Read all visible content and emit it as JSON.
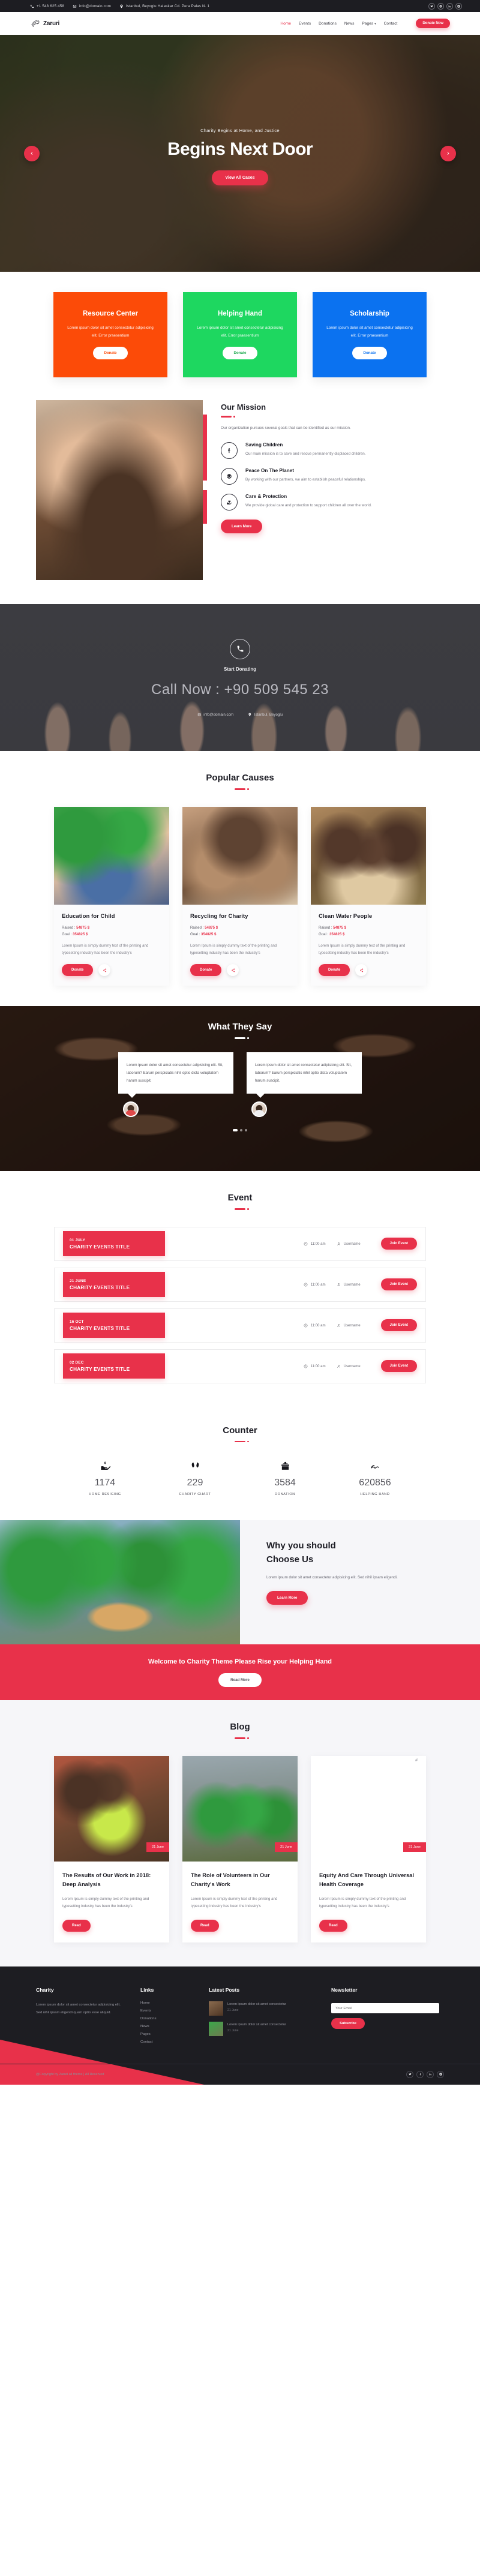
{
  "topbar": {
    "phone": "+1 548 625 458",
    "email": "info@domain.com",
    "address": "Istanbul, Beyoglu Halaskar Cd. Pera Palas N. 1",
    "socials": [
      "twitter-icon",
      "google-icon",
      "linkedin-icon",
      "instagram-icon"
    ]
  },
  "nav": {
    "brand": "Zaruri",
    "items": [
      {
        "label": "Home",
        "active": true
      },
      {
        "label": "Events",
        "active": false
      },
      {
        "label": "Donations",
        "active": false
      },
      {
        "label": "News",
        "active": false
      },
      {
        "label": "Pages",
        "active": false,
        "caret": true
      },
      {
        "label": "Contact",
        "active": false
      }
    ],
    "cta": "Donate Now"
  },
  "hero": {
    "subtitle": "Charity Begins at Home, and Justice",
    "title": "Begins Next Door",
    "button": "View All Cases",
    "prev": "‹",
    "next": "›"
  },
  "services": [
    {
      "title": "Resource Center",
      "text": "Lorem ipsum dolor sit amet consectetur adipisicing elit. Error praesentium",
      "button": "Donate",
      "bg": "#fc4b08",
      "fg": "#fc4b08"
    },
    {
      "title": "Helping Hand",
      "text": "Lorem ipsum dolor sit amet consectetur adipisicing elit. Error praesentium",
      "button": "Donate",
      "bg": "#1ed760",
      "fg": "#1ed760"
    },
    {
      "title": "Scholarship",
      "text": "Lorem ipsum dolor sit amet consectetur adipisicing elit. Error praesentium",
      "button": "Donate",
      "bg": "#0b72f0",
      "fg": "#0b72f0"
    }
  ],
  "mission": {
    "heading": "Our Mission",
    "description": "Our organization pursues several goals that can be identified as our mission.",
    "items": [
      {
        "icon": "child-icon",
        "title": "Saving Children",
        "text": "Our main mission is to save and rescue permanently displaced children."
      },
      {
        "icon": "peace-icon",
        "title": "Peace On The Planet",
        "text": "By working with our partners, we aim to establish peaceful relationships."
      },
      {
        "icon": "care-hand-icon",
        "title": "Care & Protection",
        "text": "We provide global care and protection to support children all over the world."
      }
    ],
    "button": "Learn More"
  },
  "callband": {
    "icon": "phone-icon",
    "subtitle": "Start Donating",
    "number": "Call Now : +90 509 545 23",
    "email": "info@domain.com",
    "location": "Istanbul, Beyoglu"
  },
  "causes": {
    "heading": "Popular Causes",
    "items": [
      {
        "title": "Education for Child",
        "raised_label": "Raised :",
        "raised_value": "54875 $",
        "goal_label": "Goal :",
        "goal_value": "354825 $",
        "text": "Lorem Ipsum is simply dummy text of the printing and typesetting industry has been the industry's",
        "button": "Donate",
        "share": "share-icon"
      },
      {
        "title": "Recycling for Charity",
        "raised_label": "Raised :",
        "raised_value": "54875 $",
        "goal_label": "Goal :",
        "goal_value": "354825 $",
        "text": "Lorem Ipsum is simply dummy text of the printing and typesetting industry has been the industry's",
        "button": "Donate",
        "share": "share-icon"
      },
      {
        "title": "Clean Water People",
        "raised_label": "Raised :",
        "raised_value": "54875 $",
        "goal_label": "Goal :",
        "goal_value": "354825 $",
        "text": "Lorem Ipsum is simply dummy text of the printing and typesetting industry has been the industry's",
        "button": "Donate",
        "share": "share-icon"
      }
    ]
  },
  "testimonials": {
    "heading": "What They Say",
    "items": [
      {
        "quote": "Lorem ipsum dolor sit amet consectetur adipisicing elit. Sit, laborum? Earum perspiciatis nihil optio dicta voluptatem harum suscipit."
      },
      {
        "quote": "Lorem ipsum dolor sit amet consectetur adipisicing elit. Sit, laborum? Earum perspiciatis nihil optio dicta voluptatem harum suscipit."
      }
    ]
  },
  "events": {
    "heading": "Event",
    "items": [
      {
        "date": "01 JULY",
        "title": "CHARITY EVENTS TITLE",
        "time": "11:00 am",
        "user": "Username",
        "button": "Join Event"
      },
      {
        "date": "21 JUNE",
        "title": "CHARITY EVENTS TITLE",
        "time": "11:00 am",
        "user": "Username",
        "button": "Join Event"
      },
      {
        "date": "16 OCT",
        "title": "CHARITY EVENTS TITLE",
        "time": "11:00 am",
        "user": "Username",
        "button": "Join Event"
      },
      {
        "date": "02 DEC",
        "title": "CHARITY EVENTS TITLE",
        "time": "11:00 am",
        "user": "Username",
        "button": "Join Event"
      }
    ]
  },
  "counter": {
    "heading": "Counter",
    "items": [
      {
        "icon": "hand-money-icon",
        "value": "1174",
        "label": "HOME RESIGING"
      },
      {
        "icon": "open-hands-icon",
        "value": "229",
        "label": "CHARITY CHART"
      },
      {
        "icon": "donation-box-icon",
        "value": "3584",
        "label": "DONATION"
      },
      {
        "icon": "helping-hand-icon",
        "value": "620856",
        "label": "HELPING HAND"
      }
    ]
  },
  "choose": {
    "title_line1": "Why you should",
    "title_line2": "Choose Us",
    "text": "Lorem ipsum dolor sit amet consectetur adipisicing elit. Sed nihil ipsam eligendi.",
    "button": "Learn More"
  },
  "cta": {
    "title": "Welcome to Charity Theme Please Rise your Helping Hand",
    "button": "Read More"
  },
  "blog": {
    "heading": "Blog",
    "items": [
      {
        "date": "21 June",
        "title": "The Results of Our Work in 2018: Deep Analysis",
        "text": "Lorem Ipsum is simply dummy text of the printing and typesetting industry has been the industry's",
        "button": "Read"
      },
      {
        "date": "21 June",
        "title": "The Role of Volunteers in Our Charity's Work",
        "text": "Lorem Ipsum is simply dummy text of the printing and typesetting industry has been the industry's",
        "button": "Read"
      },
      {
        "date": "21 June",
        "title": "Equity And Care Through Universal Health Coverage",
        "text": "Lorem Ipsum is simply dummy text of the printing and typesetting industry has been the industry's",
        "button": "Read"
      }
    ]
  },
  "footer": {
    "about": {
      "heading": "Charity",
      "text": "Lorem ipsum dolor sit amet consectetur adipisicing elit. Sed nihil ipsam eligendi quam optio esse aliquid."
    },
    "links": {
      "heading": "Links",
      "items": [
        "Home",
        "Events",
        "Donations",
        "News",
        "Pages",
        "Contact"
      ]
    },
    "latest": {
      "heading": "Latest Posts",
      "items": [
        {
          "title": "Lorem ipsum dolor sit amet consectetur",
          "date": "21 June"
        },
        {
          "title": "Lorem ipsum dolor sit amet consectetur",
          "date": "21 June"
        }
      ]
    },
    "newsletter": {
      "heading": "Newsletter",
      "placeholder": "Your Email",
      "button": "Subscribe"
    },
    "copyright": "@Copyright by Zaruri all theme | All Reserved",
    "socials": [
      "twitter-icon",
      "facebook-icon",
      "linkedin-icon",
      "instagram-icon"
    ]
  },
  "colors": {
    "accent": "#e8314a",
    "dark": "#1d1d22",
    "orange": "#fc4b08",
    "green": "#1ed760",
    "blue": "#0b72f0"
  }
}
